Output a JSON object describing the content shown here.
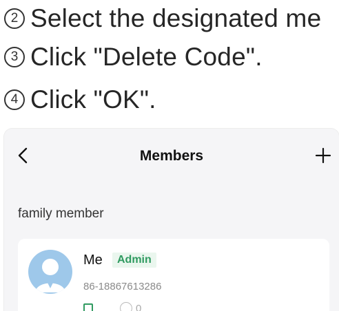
{
  "steps": [
    {
      "num": "2",
      "text": "Select the designated me"
    },
    {
      "num": "3",
      "text": "Click \"Delete Code\"."
    },
    {
      "num": "4",
      "text": "Click \"OK\"."
    }
  ],
  "screen": {
    "title": "Members",
    "section_label": "family member",
    "member": {
      "name": "Me",
      "role_badge": "Admin",
      "phone": "86-18867613286",
      "count": "0"
    }
  },
  "colors": {
    "accent_green": "#2f9a60",
    "badge_bg": "#eaf6ee",
    "avatar_blue": "#9ec8ea",
    "screen_bg": "#f5f5f7"
  },
  "icons": [
    "back-arrow-icon",
    "plus-icon",
    "avatar-icon",
    "checkbox-icon",
    "comment-icon"
  ]
}
